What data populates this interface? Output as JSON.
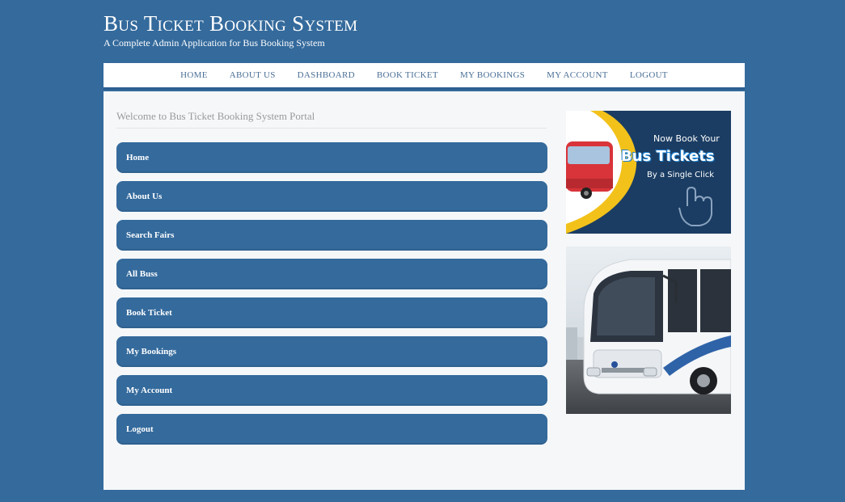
{
  "header": {
    "title": "Bus Ticket Booking System",
    "tagline": "A Complete Admin Application for Bus Booking System"
  },
  "nav": {
    "items": [
      {
        "label": "HOME"
      },
      {
        "label": "ABOUT US"
      },
      {
        "label": "DASHBOARD"
      },
      {
        "label": "BOOK TICKET"
      },
      {
        "label": "MY BOOKINGS"
      },
      {
        "label": "MY ACCOUNT"
      },
      {
        "label": "LOGOUT"
      }
    ]
  },
  "main": {
    "welcome": "Welcome to Bus Ticket Booking System Portal",
    "menu": [
      {
        "label": "Home"
      },
      {
        "label": "About Us"
      },
      {
        "label": "Search Fairs"
      },
      {
        "label": "All Buss"
      },
      {
        "label": "Book Ticket"
      },
      {
        "label": "My Bookings"
      },
      {
        "label": "My Account"
      },
      {
        "label": "Logout"
      }
    ]
  },
  "banner": {
    "line1": "Now Book Your",
    "line2": "Bus Tickets",
    "line3": "By a Single Click"
  },
  "colors": {
    "page_bg": "#346a9c",
    "button_bg": "#346a9c",
    "content_bg": "#f5f7f9",
    "banner_bg": "#1c3f66",
    "banner_accent": "#f2c21b"
  }
}
